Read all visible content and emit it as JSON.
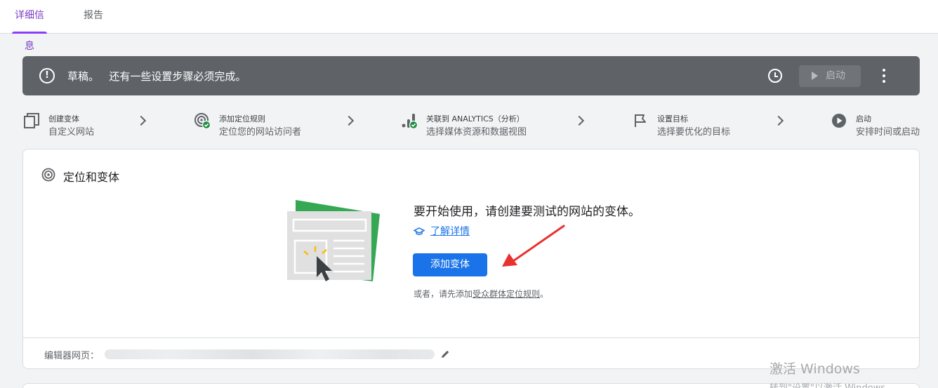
{
  "tabs": [
    {
      "label": "详细信息",
      "active": true
    },
    {
      "label": "报告",
      "active": false
    }
  ],
  "draft_bar": {
    "status": "草稿。",
    "message": "还有一些设置步骤必须完成。",
    "launch_label": "启动",
    "background": "#5f6368"
  },
  "steps": [
    {
      "title": "创建变体",
      "subtitle": "自定义网站",
      "icon": "copy-icon",
      "done": false
    },
    {
      "title": "添加定位规则",
      "subtitle": "定位您的网站访问者",
      "icon": "target-icon",
      "done": true
    },
    {
      "title": "关联到 ANALYTICS（分析）",
      "subtitle": "选择媒体资源和数据视图",
      "icon": "analytics-icon",
      "done": true
    },
    {
      "title": "设置目标",
      "subtitle": "选择要优化的目标",
      "icon": "flag-icon",
      "done": false
    },
    {
      "title": "启动",
      "subtitle": "安排时间或启动",
      "icon": "play-icon",
      "done": false
    }
  ],
  "card": {
    "header": "定位和变体",
    "cta_title": "要开始使用，请创建要测试的网站的变体。",
    "learn_more": "了解详情",
    "add_button": "添加变体",
    "alt_prefix": "或者，请先添加",
    "alt_link": "受众群体定位规则",
    "alt_suffix": "。",
    "editor_label": "编辑器网页："
  },
  "watermark": {
    "line1": "激活 Windows",
    "line2": "转到\"设置\"以激活 Windows。"
  },
  "colors": {
    "accent": "#8a3ffc",
    "primary_button": "#1a73e8",
    "check": "#1e8e3e",
    "arrow": "#e8322f"
  }
}
